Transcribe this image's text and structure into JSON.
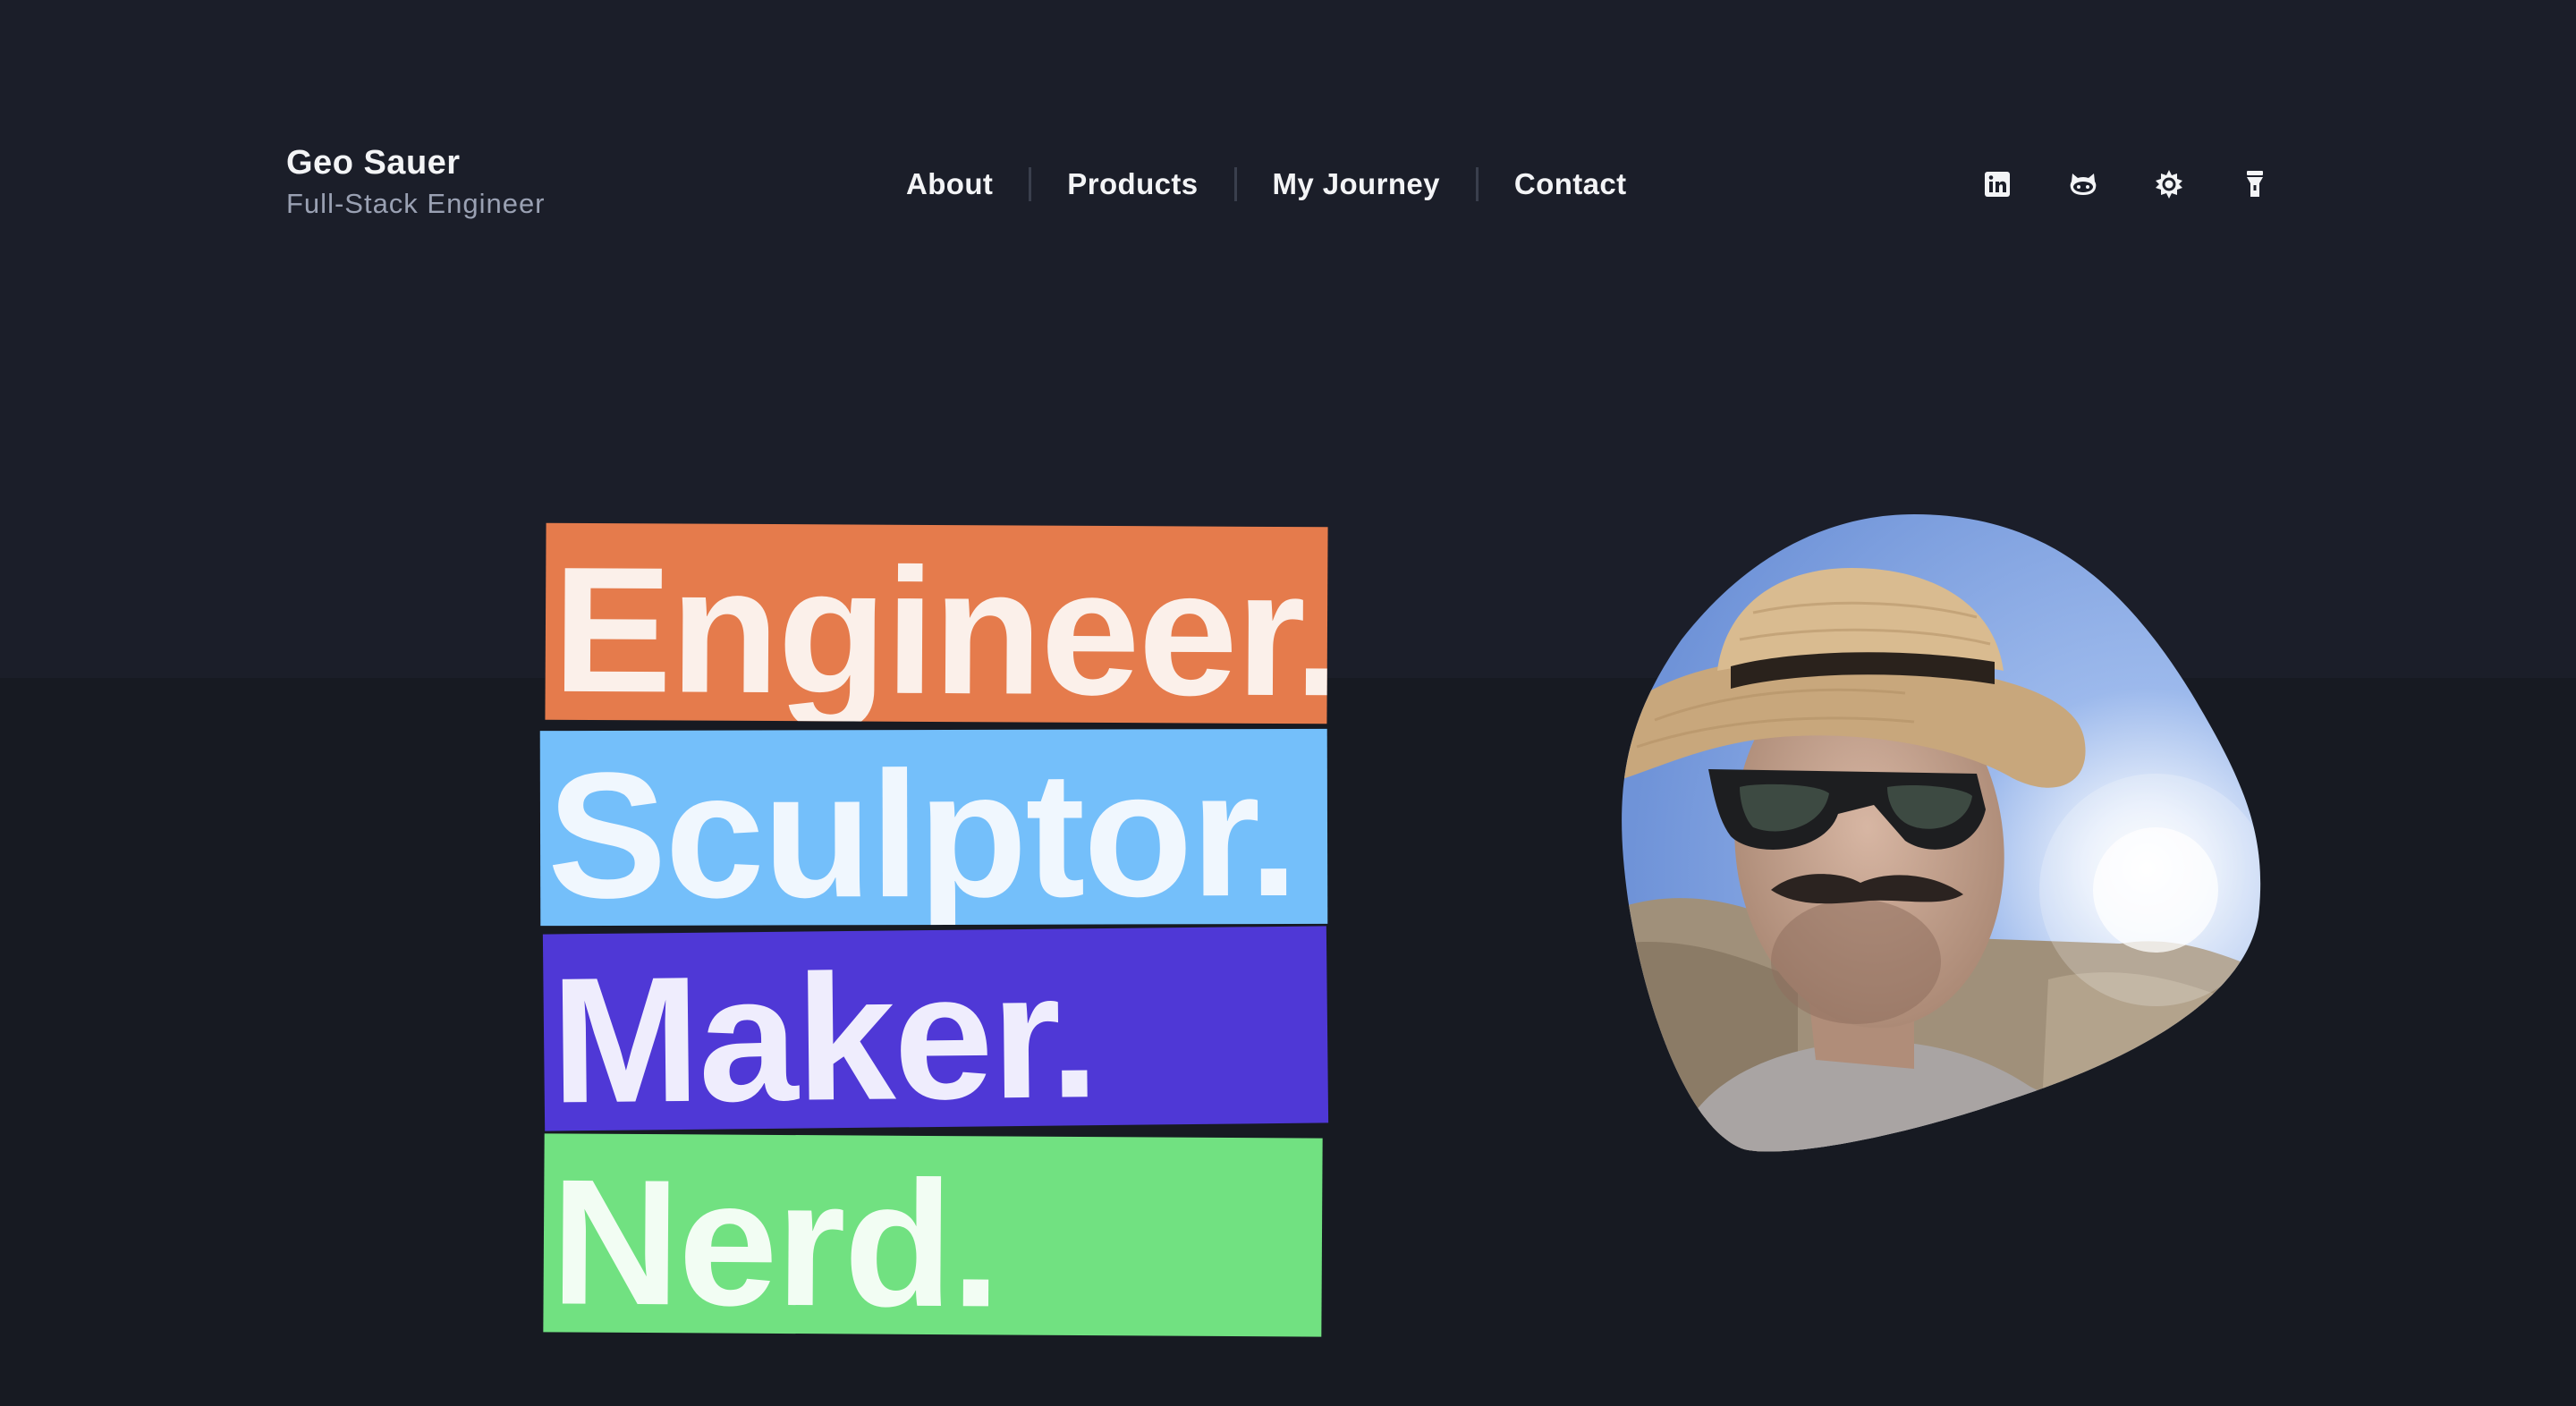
{
  "header": {
    "name": "Geo Sauer",
    "role": "Full-Stack Engineer"
  },
  "nav": [
    {
      "label": "About"
    },
    {
      "label": "Products"
    },
    {
      "label": "My Journey"
    },
    {
      "label": "Contact"
    }
  ],
  "social_icons": [
    "linkedin-icon",
    "github-icon",
    "theme-toggle-icon",
    "flashlight-icon"
  ],
  "hero": {
    "words": [
      "Engineer.",
      "Sculptor.",
      "Maker.",
      "Nerd."
    ],
    "colors": [
      "#e57b4c",
      "#74bffa",
      "#4f38d6",
      "#71e181"
    ]
  },
  "colors": {
    "background_top": "#1b1e29",
    "background_bottom": "#171a22",
    "text": "#f3f4f6",
    "muted": "#9aa1b3"
  }
}
